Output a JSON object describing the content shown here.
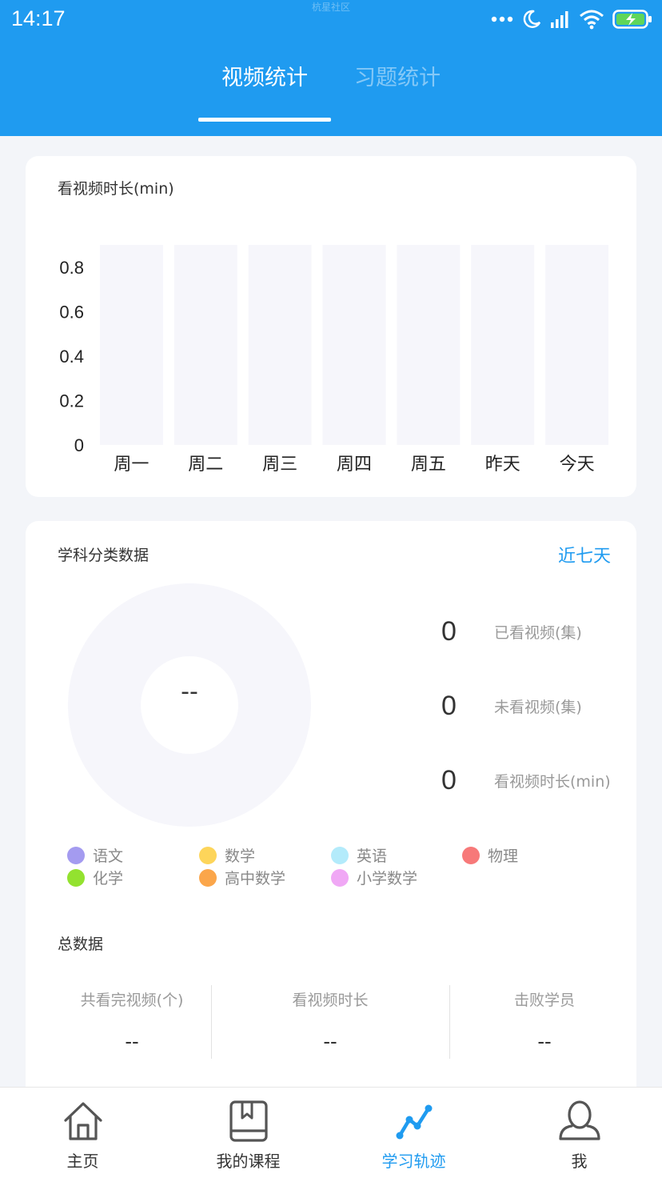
{
  "status_bar": {
    "time": "14:17",
    "center_text": "杭星社区",
    "icons": [
      "more-dots-icon",
      "moon-icon",
      "signal-icon",
      "wifi-icon",
      "battery-charging-icon"
    ]
  },
  "tabs": [
    {
      "label": "视频统计",
      "active": true
    },
    {
      "label": "习题统计",
      "active": false
    }
  ],
  "watch_chart_card": {
    "title": "看视频时长(min)"
  },
  "chart_data": {
    "type": "bar",
    "title": "看视频时长(min)",
    "categories": [
      "周一",
      "周二",
      "周三",
      "周四",
      "周五",
      "昨天",
      "今天"
    ],
    "values": [
      0,
      0,
      0,
      0,
      0,
      0,
      0
    ],
    "yticks": [
      "0",
      "0.2",
      "0.4",
      "0.6",
      "0.8"
    ],
    "ylim": [
      0,
      0.9
    ],
    "grid": false,
    "bar_background_color": "#f6f6fb"
  },
  "subject_card": {
    "title": "学科分类数据",
    "range_label": "近七天",
    "donut_center": "--",
    "stats": [
      {
        "value": "0",
        "label": "已看视频(集)"
      },
      {
        "value": "0",
        "label": "未看视频(集)"
      },
      {
        "value": "0",
        "label": "看视频时长(min)"
      }
    ],
    "legend": [
      {
        "label": "语文",
        "color": "#a49bf0"
      },
      {
        "label": "数学",
        "color": "#fdd55a"
      },
      {
        "label": "英语",
        "color": "#b3ebfb"
      },
      {
        "label": "物理",
        "color": "#f77979"
      },
      {
        "label": "化学",
        "color": "#93e22f"
      },
      {
        "label": "高中数学",
        "color": "#fba64a"
      },
      {
        "label": "小学数学",
        "color": "#f0a8f5"
      }
    ],
    "totals_title": "总数据",
    "totals": [
      {
        "label": "共看完视频(个)",
        "value": "--"
      },
      {
        "label": "看视频时长",
        "value": "--"
      },
      {
        "label": "击败学员",
        "value": "--"
      }
    ]
  },
  "bottom_nav": [
    {
      "label": "主页",
      "icon": "home-icon",
      "active": false
    },
    {
      "label": "我的课程",
      "icon": "book-icon",
      "active": false
    },
    {
      "label": "学习轨迹",
      "icon": "trend-icon",
      "active": true
    },
    {
      "label": "我",
      "icon": "user-icon",
      "active": false
    }
  ],
  "colors": {
    "primary": "#1f9bf0",
    "background": "#f3f5f9",
    "card": "#ffffff"
  }
}
